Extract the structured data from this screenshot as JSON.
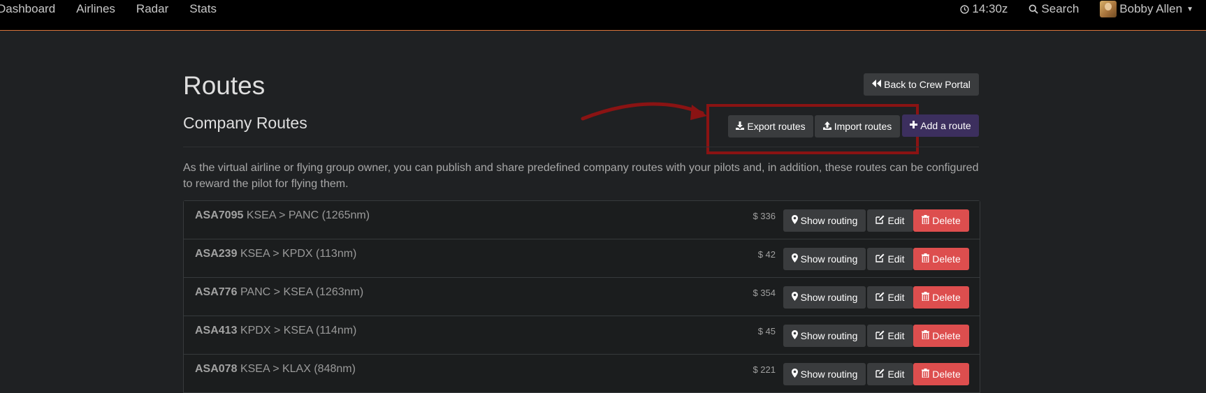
{
  "nav": {
    "links": [
      "Dashboard",
      "Airlines",
      "Radar",
      "Stats"
    ],
    "time": "14:30z",
    "search": "Search",
    "user": "Bobby Allen"
  },
  "page": {
    "title": "Routes",
    "section_title": "Company Routes",
    "back_label": "Back to Crew Portal",
    "export_label": "Export routes",
    "import_label": "Import routes",
    "add_label": "Add a route",
    "description": "As the virtual airline or flying group owner, you can publish and share predefined company routes with your pilots and, in addition, these routes can be configured to reward the pilot for flying them."
  },
  "row_actions": {
    "show_routing": "Show routing",
    "edit": "Edit",
    "delete": "Delete"
  },
  "routes": [
    {
      "code": "ASA7095",
      "path": "KSEA > PANC (1265nm)",
      "reward": "$ 336"
    },
    {
      "code": "ASA239",
      "path": "KSEA > KPDX (113nm)",
      "reward": "$ 42"
    },
    {
      "code": "ASA776",
      "path": "PANC > KSEA (1263nm)",
      "reward": "$ 354"
    },
    {
      "code": "ASA413",
      "path": "KPDX > KSEA (114nm)",
      "reward": "$ 45"
    },
    {
      "code": "ASA078",
      "path": "KSEA > KLAX (848nm)",
      "reward": "$ 221"
    }
  ],
  "colors": {
    "accent_border": "#d9743a",
    "highlight": "#8a1313",
    "danger": "#dd4e4e",
    "primary": "#3c2f5e"
  },
  "icons": {
    "clock": "clock-icon",
    "search": "search-icon",
    "back": "backward-icon",
    "export": "download-icon",
    "import": "upload-icon",
    "add": "plus-icon",
    "show": "map-marker-icon",
    "edit": "edit-icon",
    "delete": "trash-icon"
  }
}
